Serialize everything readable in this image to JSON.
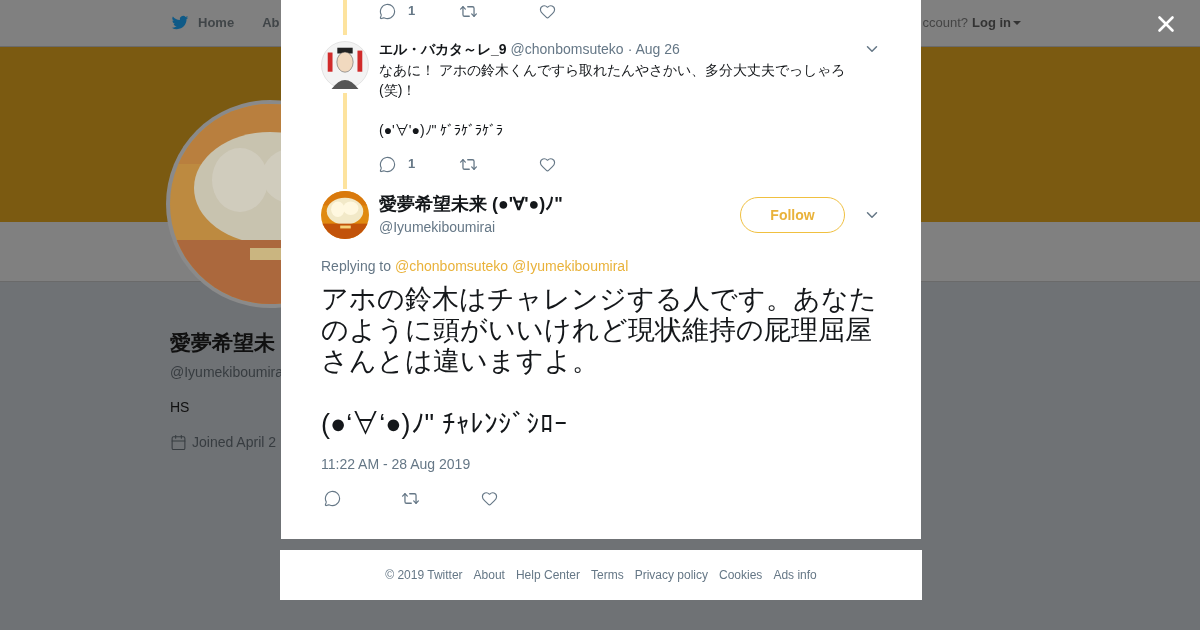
{
  "background_page": {
    "nav": {
      "items": [
        {
          "label": "Home",
          "kind": "logo"
        },
        {
          "label": "Ab",
          "kind": "text"
        }
      ],
      "account_prompt": "ccount?",
      "login": "Log in"
    },
    "profile": {
      "name": "愛夢希望未",
      "handle": "@Iyumekiboumira",
      "bio": "HS",
      "joined": "Joined April 2"
    }
  },
  "modal": {
    "earlier_actions": {
      "reply_count": "1"
    },
    "reply_tweet": {
      "name": "エル・バカタ～レ_9",
      "handle": "@chonbomsuteko",
      "date": "· Aug 26",
      "lines": [
        "なあに！ アホの鈴木くんですら取れたんやさかい、多分大丈夫でっしゃろ(笑)！",
        "(●'∀'●)ﾉ\" ｹﾞﾗｹﾞﾗｹﾞﾗ"
      ],
      "reply_count": "1"
    },
    "main_tweet": {
      "name": "愛夢希望未来 (●'∀'●)ﾉ\"",
      "handle": "@Iyumekiboumirai",
      "follow": "Follow",
      "replying_to": "Replying to",
      "mentions": [
        "@chonbomsuteko",
        "@Iyumekiboumiral"
      ],
      "paragraphs": [
        "アホの鈴木はチャレンジする人です。あなたのように頭がいいけれど現状維持の屁理屈屋さんとは違いますよ。",
        "(●‘∀‘●)ﾉ\" ﾁｬﾚﾝｼﾞｼﾛｰ"
      ],
      "timestamp": "11:22 AM - 28 Aug 2019"
    }
  },
  "footer": {
    "copyright": "© 2019 Twitter",
    "links": [
      "About",
      "Help Center",
      "Terms",
      "Privacy policy",
      "Cookies",
      "Ads info"
    ]
  }
}
